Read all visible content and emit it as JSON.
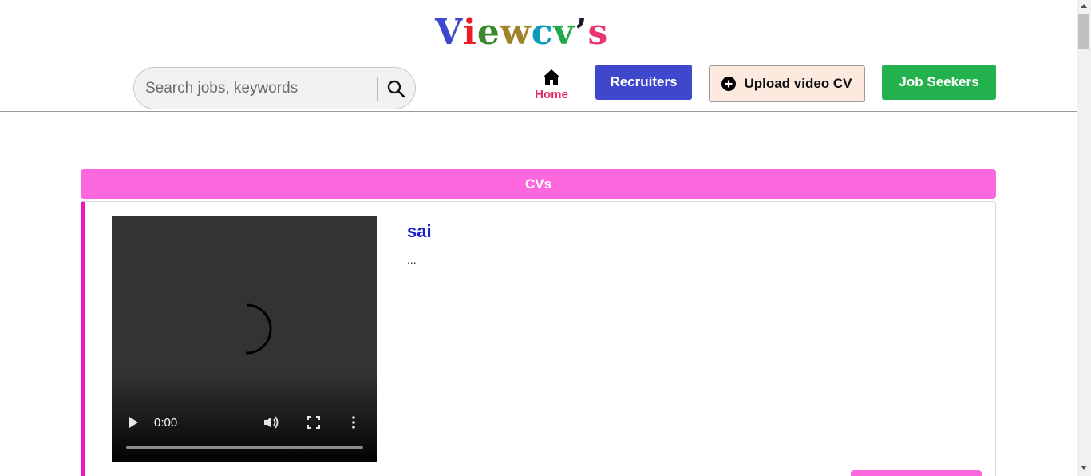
{
  "header": {
    "logo": {
      "letters": [
        {
          "char": "V",
          "color": "#3f48cc"
        },
        {
          "char": "i",
          "color": "#ed1c24"
        },
        {
          "char": "e",
          "color": "#3a8a2e"
        },
        {
          "char": "w",
          "color": "#a0822b"
        },
        {
          "char": "c",
          "color": "#0a9cbf"
        },
        {
          "char": "v",
          "color": "#1fa84a"
        },
        {
          "char": "’",
          "color": "#1a1a2e"
        },
        {
          "char": "s",
          "color": "#e8366f"
        }
      ]
    },
    "search": {
      "placeholder": "Search jobs, keywords",
      "value": "",
      "icon": "search-icon"
    },
    "nav": {
      "home_label": "Home",
      "home_icon": "home-icon",
      "recruiters_label": "Recruiters",
      "upload_label": "Upload video CV",
      "upload_icon": "plus-circle-icon",
      "job_seekers_label": "Job Seekers"
    },
    "colors": {
      "home_label": "#e8285f",
      "recruiters_bg": "#3f48cc",
      "upload_bg": "#fdeadf",
      "job_seekers_bg": "#22b14c"
    }
  },
  "main": {
    "section_title": "CVs",
    "section_color": "#fd68df",
    "cvs": [
      {
        "name": "sai",
        "description": "...",
        "video": {
          "time": "0:00",
          "progress": 0
        }
      }
    ]
  }
}
